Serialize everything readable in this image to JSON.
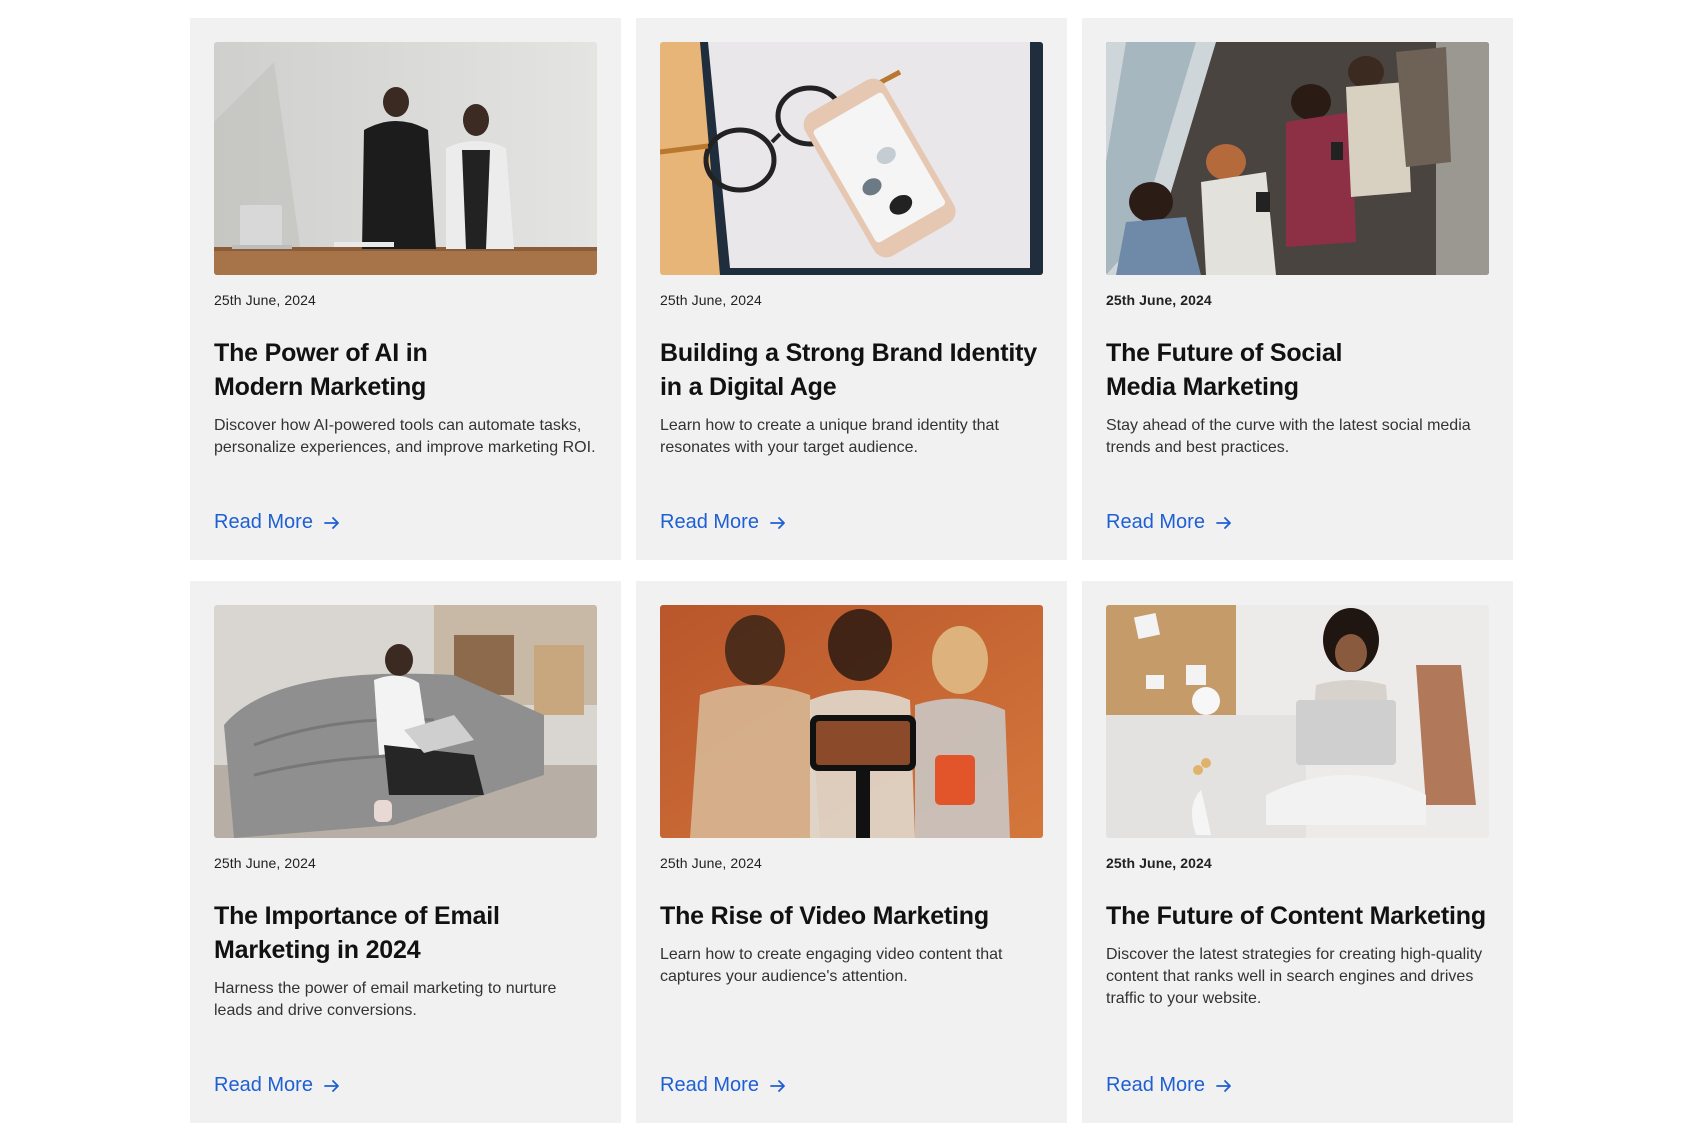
{
  "accent_color": "#1e5fd4",
  "card_background": "#f1f1f1",
  "cards": [
    {
      "image": "two colleagues discussing at a desk with a laptop",
      "date": "25th June, 2024",
      "title_line1": "The Power of AI in",
      "title_line2": "Modern Marketing",
      "description": "Discover how AI-powered tools can automate tasks, personalize experiences, and improve marketing ROI.",
      "read_more": "Read More",
      "icon": "arrow-right-icon"
    },
    {
      "image": "smartphone and glasses on a branding booklet",
      "date": "25th June, 2024",
      "title_line1": "Building a Strong Brand Identity",
      "title_line2": "in a Digital Age",
      "description": "Learn how to create a unique brand identity that resonates with your target audience.",
      "read_more": "Read More",
      "icon": "arrow-right-icon"
    },
    {
      "image": "group of people looking at their phones",
      "date": "25th June, 2024",
      "title_line1": "The Future of Social",
      "title_line2": "Media Marketing",
      "description": "Stay ahead of the curve with the latest social media trends and best practices.",
      "read_more": "Read More",
      "icon": "arrow-right-icon"
    },
    {
      "image": "woman typing on a laptop on a grey sofa",
      "date": "25th June, 2024",
      "title_line1": "The Importance of Email",
      "title_line2": "Marketing in 2024",
      "description": "Harness the power of email marketing to nurture leads and drive conversions.",
      "read_more": "Read More",
      "icon": "arrow-right-icon"
    },
    {
      "image": "phone on a tripod recording three people",
      "date": "25th June, 2024",
      "title_line1": "The Rise of Video Marketing",
      "title_line2": "",
      "description": "Learn how to create engaging video content that captures your audience's attention.",
      "read_more": "Read More",
      "icon": "arrow-right-icon"
    },
    {
      "image": "woman sitting on the floor with a laptop",
      "date": "25th June, 2024",
      "title_line1": "The Future of Content Marketing",
      "title_line2": "",
      "description": "Discover the latest strategies for creating high-quality content that ranks well in search engines and drives traffic to your website.",
      "read_more": "Read More",
      "icon": "arrow-right-icon"
    }
  ]
}
